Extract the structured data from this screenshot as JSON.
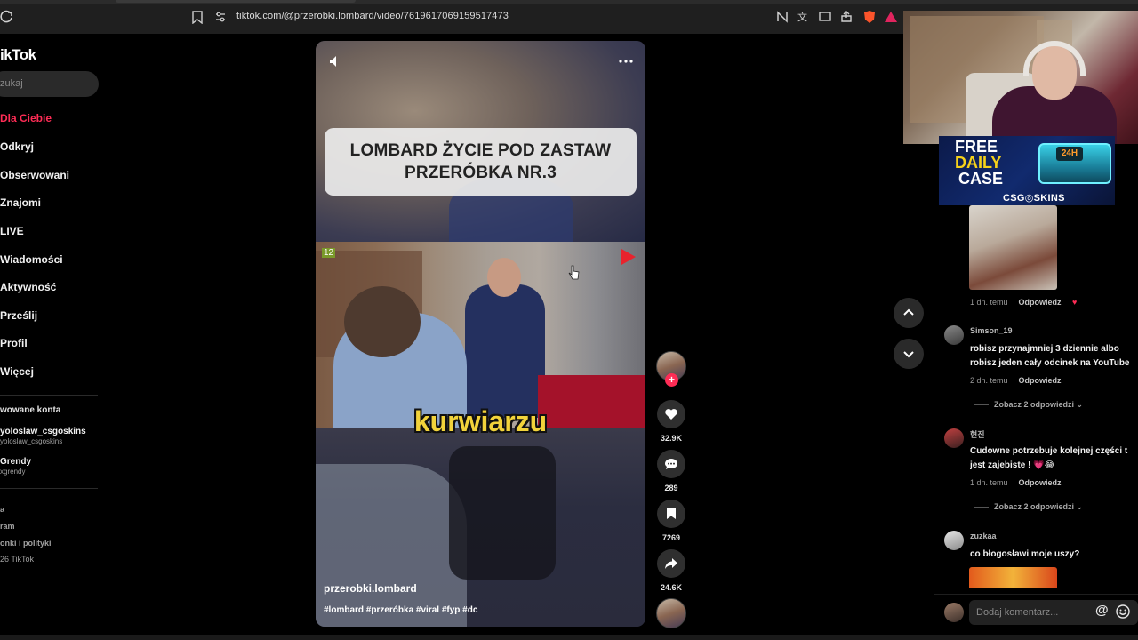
{
  "browser": {
    "url": "tiktok.com/@przerobki.lombard/video/7619617069159517473"
  },
  "sidebar": {
    "logo": "ikTok",
    "search_placeholder": "zukaj",
    "nav": [
      {
        "label": "Dla Ciebie",
        "active": true
      },
      {
        "label": "Odkryj"
      },
      {
        "label": "Obserwowani"
      },
      {
        "label": "Znajomi"
      },
      {
        "label": "LIVE"
      },
      {
        "label": "Wiadomości"
      },
      {
        "label": "Aktywność"
      },
      {
        "label": "Prześlij"
      },
      {
        "label": "Profil"
      },
      {
        "label": "Więcej"
      }
    ],
    "following_title": "wowane konta",
    "accounts": [
      {
        "name": "yoloslaw_csgoskins",
        "handle": "yoloslaw_csgoskins"
      },
      {
        "name": "Grendy",
        "handle": "xgrendy"
      }
    ],
    "footer": [
      "a",
      "ram",
      "onki i polityki",
      "26 TikTok"
    ]
  },
  "video": {
    "title_line1": "LOMBARD ŻYCIE POD ZASTAW",
    "title_line2": "PRZERÓBKA NR.3",
    "subtitle": "kurwiarzu",
    "age_badge": "12",
    "author": "przerobki.lombard",
    "hashtags": "#lombard #przeróbka #viral #fyp #dc"
  },
  "actions": {
    "likes": "32.9K",
    "comments": "289",
    "saves": "7269",
    "shares": "24.6K",
    "follow_plus": "+"
  },
  "comments": {
    "items": [
      {
        "user": "",
        "time": "1 dn. temu",
        "reply": "Odpowiedz",
        "text": ""
      },
      {
        "user": "Simson_19",
        "text_line1": "robisz przynajmniej 3 dziennie albo",
        "text_line2": "robisz jeden cały odcinek na YouTube",
        "time": "2 dn. temu",
        "reply": "Odpowiedz",
        "more": "Zobacz 2 odpowiedzi"
      },
      {
        "user": "현진",
        "text_line1": "Cudowne potrzebuje kolejnej części t",
        "text_line2": "jest zajebiste ! 💗😂",
        "time": "1 dn. temu",
        "reply": "Odpowiedz",
        "more": "Zobacz 2 odpowiedzi"
      },
      {
        "user": "zuzkaa",
        "text_line1": "co błogosławi moje uszy?"
      }
    ],
    "input_placeholder": "Dodaj komentarz...",
    "at_symbol": "@"
  },
  "ad": {
    "line1": "FREE",
    "line2": "DAILY",
    "line3": "CASE",
    "brand": "CSG◎SKINS",
    "badge": "24H"
  },
  "colors": {
    "accent": "#fe2c55",
    "subtitle": "#f2d33b"
  }
}
